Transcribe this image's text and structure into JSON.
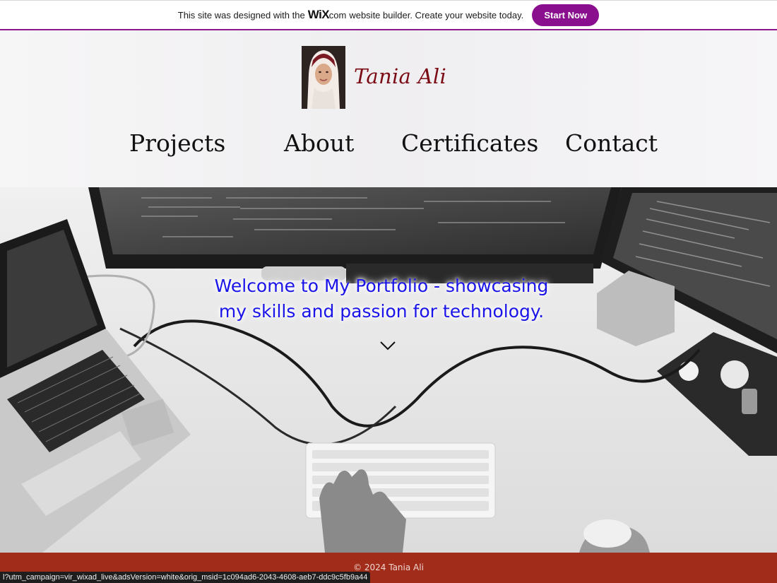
{
  "banner": {
    "text_before": "This site was designed with the",
    "logo": "WiX",
    "logo_suffix": ".com",
    "text_after": "website builder. Create your website today.",
    "cta_label": "Start Now",
    "accent": "#8a0f8e"
  },
  "header": {
    "site_name": "Tania Ali",
    "nav": [
      {
        "label": "Projects"
      },
      {
        "label": "About"
      },
      {
        "label": "Certificates"
      },
      {
        "label": "Contact"
      }
    ],
    "brand_color": "#7a0a14"
  },
  "hero": {
    "headline_line1": "Welcome to My Portfolio - showcasing",
    "headline_line2": "my skills and passion for technology.",
    "scroll_icon": "chevron-down-icon",
    "headline_color": "#1a14e8"
  },
  "footer": {
    "copyright": "© 2024 Tania Ali",
    "background": "#a12c1a"
  },
  "status_bar": {
    "url": "l?utm_campaign=vir_wixad_live&adsVersion=white&orig_msid=1c094ad6-2043-4608-aeb7-ddc9c5fb9a44"
  }
}
